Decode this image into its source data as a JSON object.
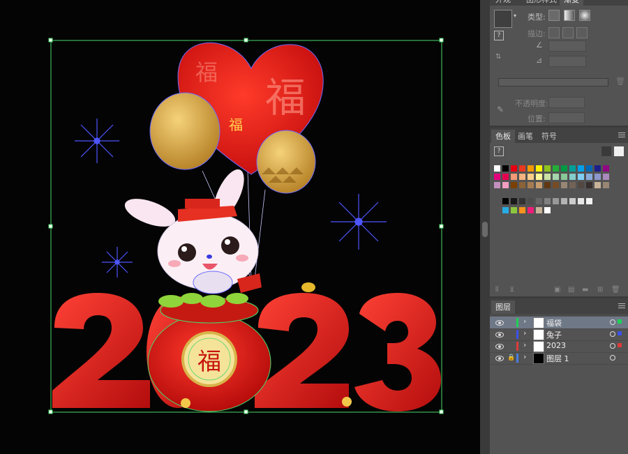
{
  "artwork": {
    "char_fu_large": "福",
    "char_fu_small": "福",
    "char_fu_pink": "福",
    "char_fu_bag": "福",
    "year_digits": [
      "2",
      "0",
      "2",
      "3"
    ]
  },
  "properties_panel": {
    "top_tabs": [
      "外观",
      "图形样式",
      "渐变"
    ],
    "type_label": "类型:",
    "stroke_label": "描边:",
    "opacity_label": "不透明度:",
    "position_label": "位置:"
  },
  "swatches_panel": {
    "tabs": [
      "色板",
      "画笔",
      "符号"
    ],
    "colors": [
      "#ffffff",
      "#000000",
      "#e60012",
      "#e83820",
      "#f39800",
      "#fff100",
      "#8fc31f",
      "#22ac38",
      "#009944",
      "#009e96",
      "#00a0e9",
      "#0068b7",
      "#1d2088",
      "#920783",
      "#e4007f",
      "#e5004f",
      "#f29b76",
      "#f6b37f",
      "#facd89",
      "#fff799",
      "#c9e1a2",
      "#a5d4ad",
      "#89c997",
      "#84ccc9",
      "#7ecef4",
      "#88abda",
      "#8c97cb",
      "#aa89bd",
      "#c490bf",
      "#f19ec2",
      "#7b3f00",
      "#8c6239",
      "#a67c52",
      "#c69c6d",
      "#603813",
      "#754c24",
      "#998675",
      "#736357",
      "#534741",
      "#362f2d",
      "#c7b299",
      "#998675"
    ],
    "grays": [
      "#000000",
      "#1a1a1a",
      "#333333",
      "#4d4d4d",
      "#666666",
      "#808080",
      "#999999",
      "#b3b3b3",
      "#cccccc",
      "#e6e6e6",
      "#f2f2f2"
    ],
    "extra": [
      "#29abe2",
      "#8cc63f",
      "#f7931e",
      "#ed1e79",
      "#c7b299",
      "#ffffff"
    ]
  },
  "layers_panel": {
    "tab": "图层",
    "layers": [
      {
        "name": "福袋",
        "color": "#1fd158",
        "selected": true,
        "locked": false
      },
      {
        "name": "兔子",
        "color": "#3d52e8",
        "selected": false,
        "locked": false
      },
      {
        "name": "2023",
        "color": "#e03a3a",
        "selected": false,
        "locked": false
      },
      {
        "name": "图层 1",
        "color": "#4a7de0",
        "selected": false,
        "locked": true
      }
    ]
  }
}
